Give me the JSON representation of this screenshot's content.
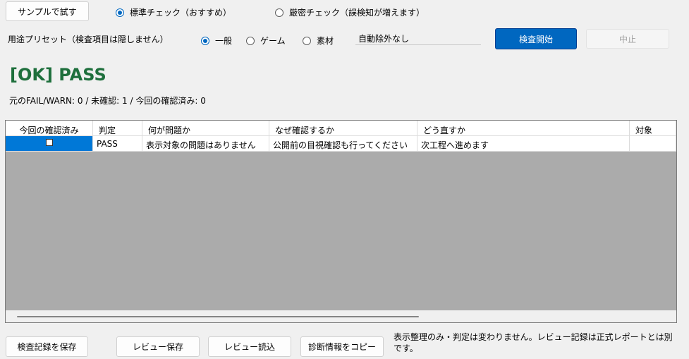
{
  "toolbar": {
    "sample_label": "サンプルで試す",
    "mode_standard": "標準チェック（おすすめ）",
    "mode_strict": "厳密チェック（誤検知が増えます）"
  },
  "preset": {
    "label": "用途プリセット（検査項目は隠しません）",
    "general": "一般",
    "game": "ゲーム",
    "material": "素材",
    "exclusion_value": "自動除外なし",
    "start_label": "検査開始",
    "stop_label": "中止"
  },
  "result": {
    "title": "[OK] PASS",
    "counts": "元のFAIL/WARN: 0 / 未確認: 1 / 今回の確認済み: 0"
  },
  "grid": {
    "headers": [
      "今回の確認済み",
      "判定",
      "何が問題か",
      "なぜ確認するか",
      "どう直すか",
      "対象"
    ],
    "rows": [
      {
        "checked": false,
        "verdict": "PASS",
        "issue": "表示対象の問題はありません",
        "reason": "公開前の目視確認も行ってください",
        "fix": "次工程へ進めます",
        "target": ""
      }
    ]
  },
  "footer": {
    "save_record": "検査記録を保存",
    "review_save": "レビュー保存",
    "review_load": "レビュー読込",
    "copy_diag": "診断情報をコピー",
    "note": "表示整理のみ・判定は変わりません。レビュー記録は正式レポートとは別です。"
  },
  "colors": {
    "accent": "#0067c0",
    "pass_green": "#1e6f3c",
    "selection": "#0078d7",
    "grid_empty": "#ababab"
  }
}
